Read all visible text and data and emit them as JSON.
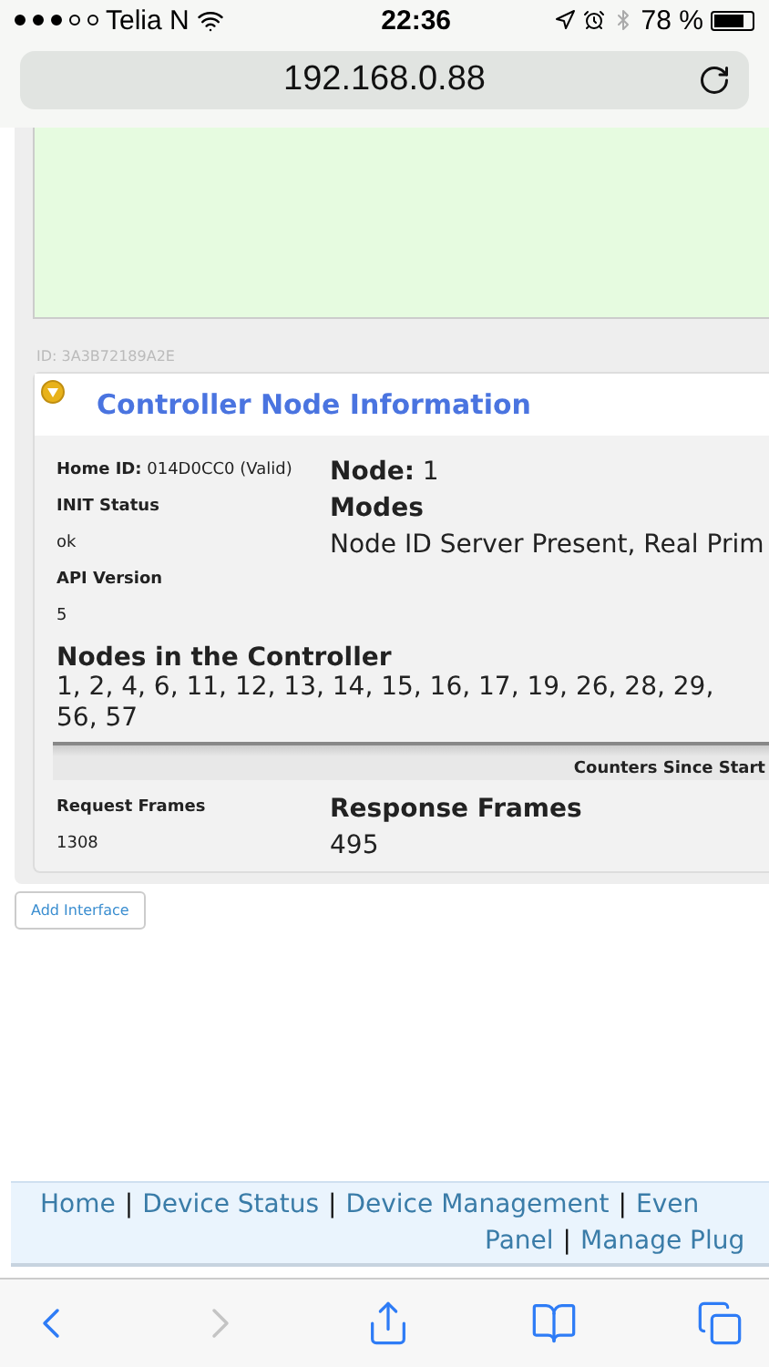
{
  "status_bar": {
    "carrier": "Telia N",
    "signal_dots": [
      true,
      true,
      true,
      false,
      false
    ],
    "time": "22:36",
    "battery": "78 %"
  },
  "address_bar": {
    "url": "192.168.0.88"
  },
  "page": {
    "node_id": "ID: 3A3B72189A2E",
    "panel": {
      "title": "Controller Node Information",
      "expanded": true,
      "home_id_label": "Home ID:",
      "home_id_value": "014D0CC0 (Valid)",
      "node_label": "Node:",
      "node_value": "1",
      "init_label": "INIT Status",
      "init_value": "ok",
      "modes_label": "Modes",
      "modes_value": "Node ID Server Present, Real Prim",
      "api_label": "API Version",
      "api_value": "5",
      "nodes_label": "Nodes in the Controller",
      "nodes_lines": [
        "1, 2, 4, 6, 11, 12, 13, 14, 15, 16, 17, 19, 26, 28, 29,",
        "56, 57"
      ],
      "counters_title": "Counters Since Start",
      "request_label": "Request Frames",
      "request_value": "1308",
      "response_label": "Response Frames",
      "response_value": "495"
    },
    "add_button": "Add Interface",
    "footer_lines": [
      [
        {
          "kind": "link",
          "text": "Home"
        },
        {
          "kind": "separator",
          "text": "|"
        },
        {
          "kind": "link",
          "text": "Device Status"
        },
        {
          "kind": "separator",
          "text": "|"
        },
        {
          "kind": "link",
          "text": "Device Management"
        },
        {
          "kind": "separator",
          "text": "|"
        },
        {
          "kind": "link",
          "text": "Even"
        }
      ],
      [
        {
          "kind": "link",
          "text": "Panel"
        },
        {
          "kind": "separator",
          "text": "|"
        },
        {
          "kind": "link",
          "text": "Manage Plug"
        }
      ]
    ]
  },
  "toolbar": [
    {
      "kind": "back",
      "disabled": false
    },
    {
      "kind": "forward",
      "disabled": true
    },
    {
      "kind": "share",
      "disabled": false
    },
    {
      "kind": "bookmarks",
      "disabled": false
    },
    {
      "kind": "tabs",
      "disabled": false
    }
  ]
}
